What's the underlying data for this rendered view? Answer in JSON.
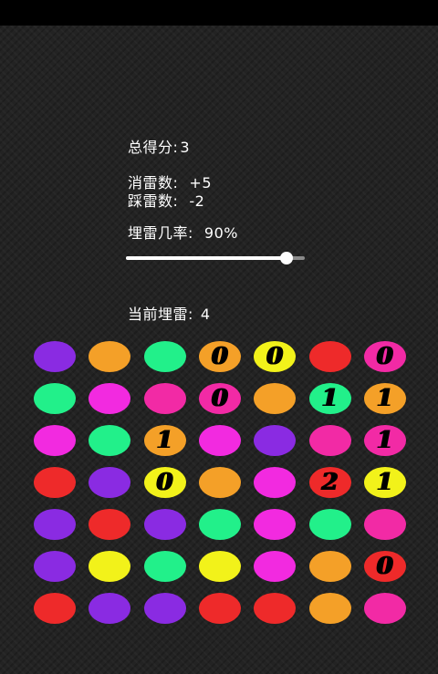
{
  "score": {
    "label": "总得分:",
    "value": "3"
  },
  "cleared": {
    "label": "消雷数:",
    "value": "+5"
  },
  "stepped": {
    "label": "踩雷数:",
    "value": "-2"
  },
  "mine_rate": {
    "label": "埋雷几率:",
    "value": "90%",
    "level": 0.9
  },
  "current_mines": {
    "label": "当前埋雷:",
    "value": "4"
  },
  "colors": {
    "purple": "#8a2be2",
    "orange": "#f4a028",
    "green": "#22f08a",
    "yellow": "#f2f21a",
    "red": "#ee2a2a",
    "pink": "#f22aa5",
    "magenta": "#f22ae0"
  },
  "board": [
    [
      {
        "c": "purple"
      },
      {
        "c": "orange"
      },
      {
        "c": "green"
      },
      {
        "c": "orange",
        "n": "0"
      },
      {
        "c": "yellow",
        "n": "0"
      },
      {
        "c": "red"
      },
      {
        "c": "pink",
        "n": "0"
      }
    ],
    [
      {
        "c": "green"
      },
      {
        "c": "magenta"
      },
      {
        "c": "pink"
      },
      {
        "c": "pink",
        "n": "0"
      },
      {
        "c": "orange"
      },
      {
        "c": "green",
        "n": "1"
      },
      {
        "c": "orange",
        "n": "1"
      }
    ],
    [
      {
        "c": "magenta"
      },
      {
        "c": "green"
      },
      {
        "c": "orange",
        "n": "1"
      },
      {
        "c": "magenta"
      },
      {
        "c": "purple"
      },
      {
        "c": "pink"
      },
      {
        "c": "pink",
        "n": "1"
      }
    ],
    [
      {
        "c": "red"
      },
      {
        "c": "purple"
      },
      {
        "c": "yellow",
        "n": "0"
      },
      {
        "c": "orange"
      },
      {
        "c": "magenta"
      },
      {
        "c": "red",
        "n": "2"
      },
      {
        "c": "yellow",
        "n": "1"
      }
    ],
    [
      {
        "c": "purple"
      },
      {
        "c": "red"
      },
      {
        "c": "purple"
      },
      {
        "c": "green"
      },
      {
        "c": "magenta"
      },
      {
        "c": "green"
      },
      {
        "c": "pink"
      }
    ],
    [
      {
        "c": "purple"
      },
      {
        "c": "yellow"
      },
      {
        "c": "green"
      },
      {
        "c": "yellow"
      },
      {
        "c": "magenta"
      },
      {
        "c": "orange"
      },
      {
        "c": "red",
        "n": "0"
      }
    ],
    [
      {
        "c": "red"
      },
      {
        "c": "purple"
      },
      {
        "c": "purple"
      },
      {
        "c": "red"
      },
      {
        "c": "red"
      },
      {
        "c": "orange"
      },
      {
        "c": "pink"
      }
    ]
  ]
}
